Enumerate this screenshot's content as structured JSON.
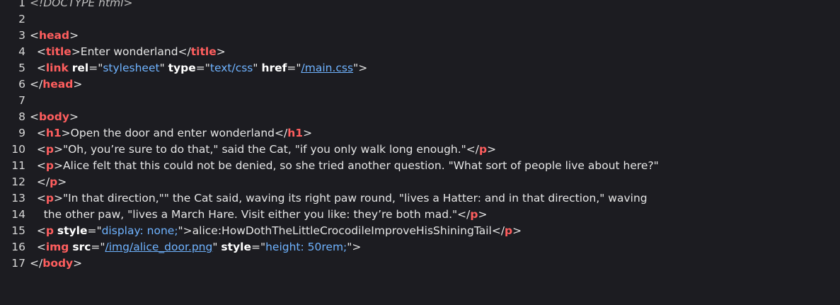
{
  "editor": {
    "lines": [
      {
        "num": "1",
        "parts": [
          {
            "t": "<!DOCTYPE html>",
            "c": "doctype"
          }
        ]
      },
      {
        "num": "2",
        "parts": []
      },
      {
        "num": "3",
        "parts": [
          {
            "t": "<",
            "c": "punct"
          },
          {
            "t": "head",
            "c": "tag"
          },
          {
            "t": ">",
            "c": "punct"
          }
        ]
      },
      {
        "num": "4",
        "parts": [
          {
            "t": "  <",
            "c": "punct"
          },
          {
            "t": "title",
            "c": "tag"
          },
          {
            "t": ">Enter wonderland</",
            "c": "txt"
          },
          {
            "t": "title",
            "c": "tag"
          },
          {
            "t": ">",
            "c": "punct"
          }
        ]
      },
      {
        "num": "5",
        "parts": [
          {
            "t": "  <",
            "c": "punct"
          },
          {
            "t": "link",
            "c": "tag"
          },
          {
            "t": " ",
            "c": "txt"
          },
          {
            "t": "rel",
            "c": "attr"
          },
          {
            "t": "=\"",
            "c": "punct"
          },
          {
            "t": "stylesheet",
            "c": "val"
          },
          {
            "t": "\" ",
            "c": "punct"
          },
          {
            "t": "type",
            "c": "attr"
          },
          {
            "t": "=\"",
            "c": "punct"
          },
          {
            "t": "text/css",
            "c": "val"
          },
          {
            "t": "\" ",
            "c": "punct"
          },
          {
            "t": "href",
            "c": "attr"
          },
          {
            "t": "=\"",
            "c": "punct"
          },
          {
            "t": "/main.css",
            "c": "link"
          },
          {
            "t": "\">",
            "c": "punct"
          }
        ]
      },
      {
        "num": "6",
        "parts": [
          {
            "t": "</",
            "c": "punct"
          },
          {
            "t": "head",
            "c": "tag"
          },
          {
            "t": ">",
            "c": "punct"
          }
        ]
      },
      {
        "num": "7",
        "parts": []
      },
      {
        "num": "8",
        "parts": [
          {
            "t": "<",
            "c": "punct"
          },
          {
            "t": "body",
            "c": "tag"
          },
          {
            "t": ">",
            "c": "punct"
          }
        ]
      },
      {
        "num": "9",
        "parts": [
          {
            "t": "  <",
            "c": "punct"
          },
          {
            "t": "h1",
            "c": "tag"
          },
          {
            "t": ">Open the door and enter wonderland</",
            "c": "txt"
          },
          {
            "t": "h1",
            "c": "tag"
          },
          {
            "t": ">",
            "c": "punct"
          }
        ]
      },
      {
        "num": "10",
        "parts": [
          {
            "t": "  <",
            "c": "punct"
          },
          {
            "t": "p",
            "c": "tag"
          },
          {
            "t": ">\"Oh, you’re sure to do that,\" said the Cat, \"if you only walk long enough.\"</",
            "c": "txt"
          },
          {
            "t": "p",
            "c": "tag"
          },
          {
            "t": ">",
            "c": "punct"
          }
        ]
      },
      {
        "num": "11",
        "parts": [
          {
            "t": "  <",
            "c": "punct"
          },
          {
            "t": "p",
            "c": "tag"
          },
          {
            "t": ">Alice felt that this could not be denied, so she tried another question. \"What sort of people live about here?\"",
            "c": "txt"
          }
        ]
      },
      {
        "num": "12",
        "parts": [
          {
            "t": "  </",
            "c": "punct"
          },
          {
            "t": "p",
            "c": "tag"
          },
          {
            "t": ">",
            "c": "punct"
          }
        ]
      },
      {
        "num": "13",
        "parts": [
          {
            "t": "  <",
            "c": "punct"
          },
          {
            "t": "p",
            "c": "tag"
          },
          {
            "t": ">\"In that direction,\"\" the Cat said, waving its right paw round, \"lives a Hatter: and in that direction,\" waving",
            "c": "txt"
          }
        ]
      },
      {
        "num": "14",
        "parts": [
          {
            "t": "    the other paw, \"lives a March Hare. Visit either you like: they’re both mad.\"</",
            "c": "txt"
          },
          {
            "t": "p",
            "c": "tag"
          },
          {
            "t": ">",
            "c": "punct"
          }
        ]
      },
      {
        "num": "15",
        "parts": [
          {
            "t": "  <",
            "c": "punct"
          },
          {
            "t": "p",
            "c": "tag"
          },
          {
            "t": " ",
            "c": "txt"
          },
          {
            "t": "style",
            "c": "attr"
          },
          {
            "t": "=\"",
            "c": "punct"
          },
          {
            "t": "display: none;",
            "c": "val"
          },
          {
            "t": "\">alice:HowDothTheLittleCrocodileImproveHisShiningTail</",
            "c": "txt"
          },
          {
            "t": "p",
            "c": "tag"
          },
          {
            "t": ">",
            "c": "punct"
          }
        ]
      },
      {
        "num": "16",
        "parts": [
          {
            "t": "  <",
            "c": "punct"
          },
          {
            "t": "img",
            "c": "tag"
          },
          {
            "t": " ",
            "c": "txt"
          },
          {
            "t": "src",
            "c": "attr"
          },
          {
            "t": "=\"",
            "c": "punct"
          },
          {
            "t": "/img/alice_door.png",
            "c": "link"
          },
          {
            "t": "\" ",
            "c": "punct"
          },
          {
            "t": "style",
            "c": "attr"
          },
          {
            "t": "=\"",
            "c": "punct"
          },
          {
            "t": "height: 50rem;",
            "c": "val"
          },
          {
            "t": "\">",
            "c": "punct"
          }
        ]
      },
      {
        "num": "17",
        "parts": [
          {
            "t": "</",
            "c": "punct"
          },
          {
            "t": "body",
            "c": "tag"
          },
          {
            "t": ">",
            "c": "punct"
          }
        ]
      }
    ]
  }
}
